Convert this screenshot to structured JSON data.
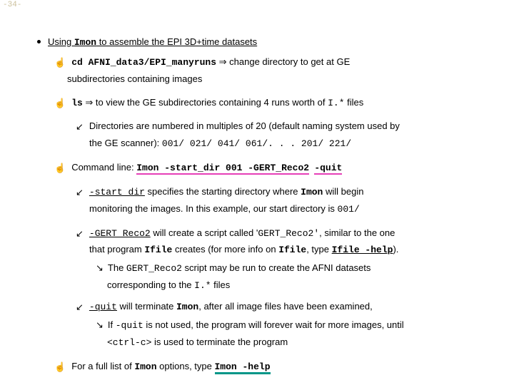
{
  "page_num": "-34-",
  "t0": "Using ",
  "imon": "Imon",
  "t0b": " to assemble the EPI 3D+time datasets",
  "cd_cmd": "cd AFNI_data3/EPI_manyruns",
  "arrow": " ⇒ ",
  "t1": "change directory to get at GE",
  "t1b": "subdirectories containing images",
  "ls": "ls",
  "t2": "to view the GE subdirectories containing 4 runs worth of ",
  "istar": "I.*",
  "t2b": " files",
  "t3": "Directories are numbered in multiples of 20 (default naming system used by",
  "t3b": "the GE scanner): ",
  "dirs": "001/   021/   041/   061/. . . 201/   221/",
  "t4a": "Command line: ",
  "cmd1": "Imon -start_dir 001 -GERT_Reco2",
  "cmd2": "-quit",
  "opt_start": "-start_dir",
  "t5": " specifies the starting directory where ",
  "t5b": " will begin",
  "t5c": "monitoring the images.  In this example, our start directory is ",
  "d001": "001/",
  "opt_gert": "-GERT_Reco2",
  "t6": " will create a script called '",
  "gert2": "GERT_Reco2'",
  "t6b": ", similar to the one",
  "t6c": "that program ",
  "ifile": "Ifile",
  "t6d": " creates (for more info on ",
  "t6e": ", type ",
  "ifile_help": "Ifile -help",
  "t6f": ").",
  "t7a": "The ",
  "gert3": "GERT_Reco2",
  "t7b": " script may be run to create the AFNI datasets",
  "t7c": "corresponding to the ",
  "t7d": " files",
  "opt_quit": "-quit",
  "t8": " will terminate ",
  "t8b": ", after all image files have been examined,",
  "t9a": "If ",
  "t9b": " is not used, the program will forever wait for more images,  until",
  "ctrlc": "<ctrl-c>",
  "t9c": " is used to terminate the program",
  "t10a": "For a full list of ",
  "t10b": " options, type ",
  "imon_help": "Imon -help"
}
